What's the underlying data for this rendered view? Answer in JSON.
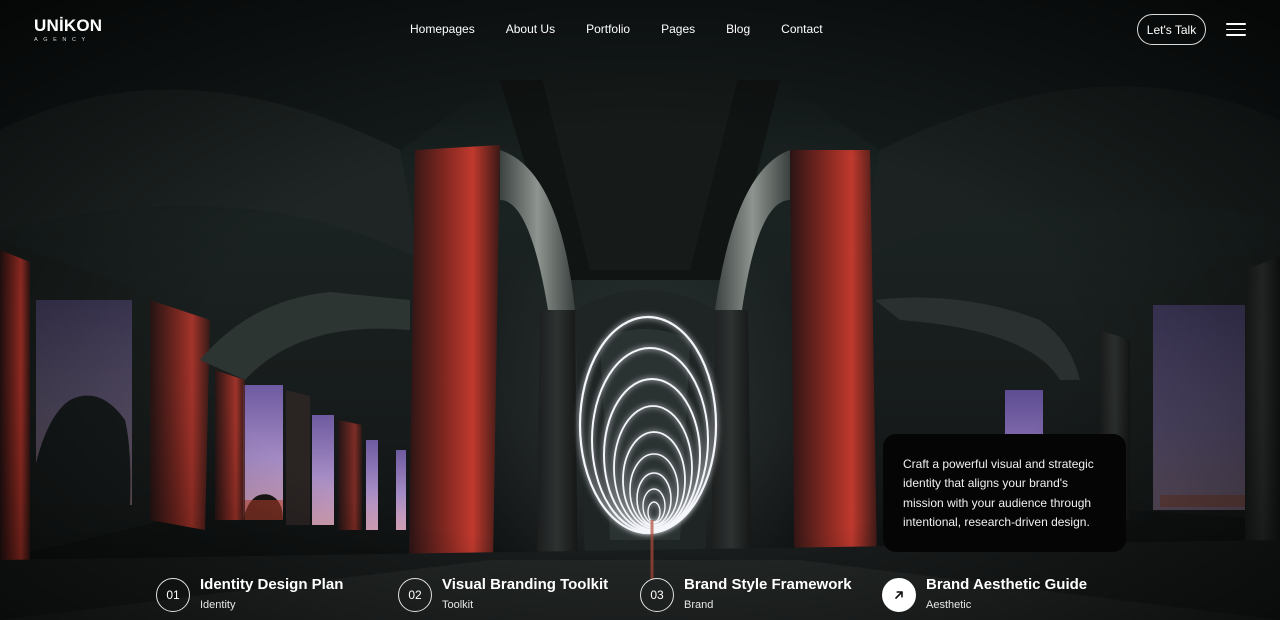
{
  "brand": {
    "name": "UNİKON",
    "tagline": "AGENCY"
  },
  "nav": {
    "items": [
      "Homepages",
      "About Us",
      "Portfolio",
      "Pages",
      "Blog",
      "Contact"
    ],
    "cta_label": "Let's Talk",
    "menu_icon": "hamburger-icon"
  },
  "hero": {
    "description": "Craft a powerful visual and strategic identity that aligns your brand's mission with your audience through intentional, research-driven design."
  },
  "features": [
    {
      "number": "01",
      "title": "Identity Design Plan",
      "tag": "Identity",
      "active": false
    },
    {
      "number": "02",
      "title": "Visual Branding Toolkit",
      "tag": "Toolkit",
      "active": false
    },
    {
      "number": "03",
      "title": "Brand Style Framework",
      "tag": "Brand",
      "active": false
    },
    {
      "number": "",
      "title": "Brand Aesthetic Guide",
      "tag": "Aesthetic",
      "active": true,
      "icon": "arrow-up-right-icon"
    }
  ],
  "colors": {
    "accent_red": "#b9352a",
    "sky_purple": "#8e72b8",
    "card_bg": "#050505"
  }
}
